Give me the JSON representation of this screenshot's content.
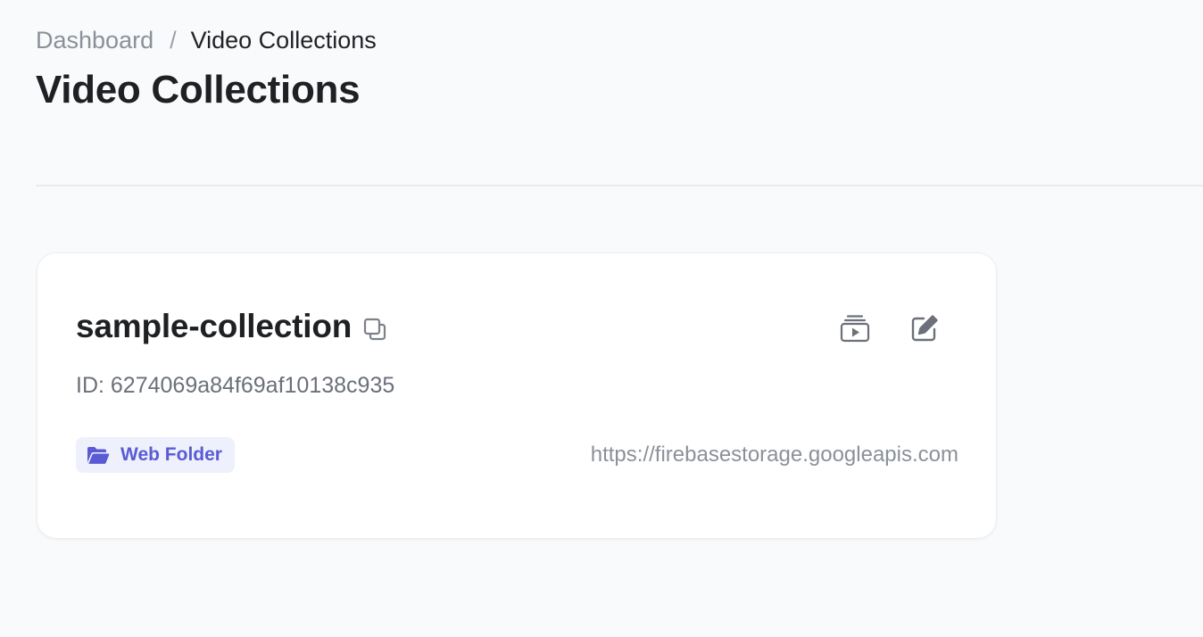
{
  "breadcrumb": {
    "root": "Dashboard",
    "separator": "/",
    "current": "Video Collections"
  },
  "page": {
    "title": "Video Collections"
  },
  "collection": {
    "name": "sample-collection",
    "id_text": "ID: 6274069a84f69af10138c935",
    "source_type": "Web Folder",
    "url": "https://firebasestorage.googleapis.com",
    "icons": {
      "copy": "copy-icon",
      "videos": "video-library-icon",
      "edit": "edit-icon",
      "folder": "folder-open-icon"
    }
  },
  "colors": {
    "accent": "#5a5bd4",
    "badge_bg": "#eef0fb",
    "muted_text": "#8b9099",
    "background": "#f9fafb"
  }
}
